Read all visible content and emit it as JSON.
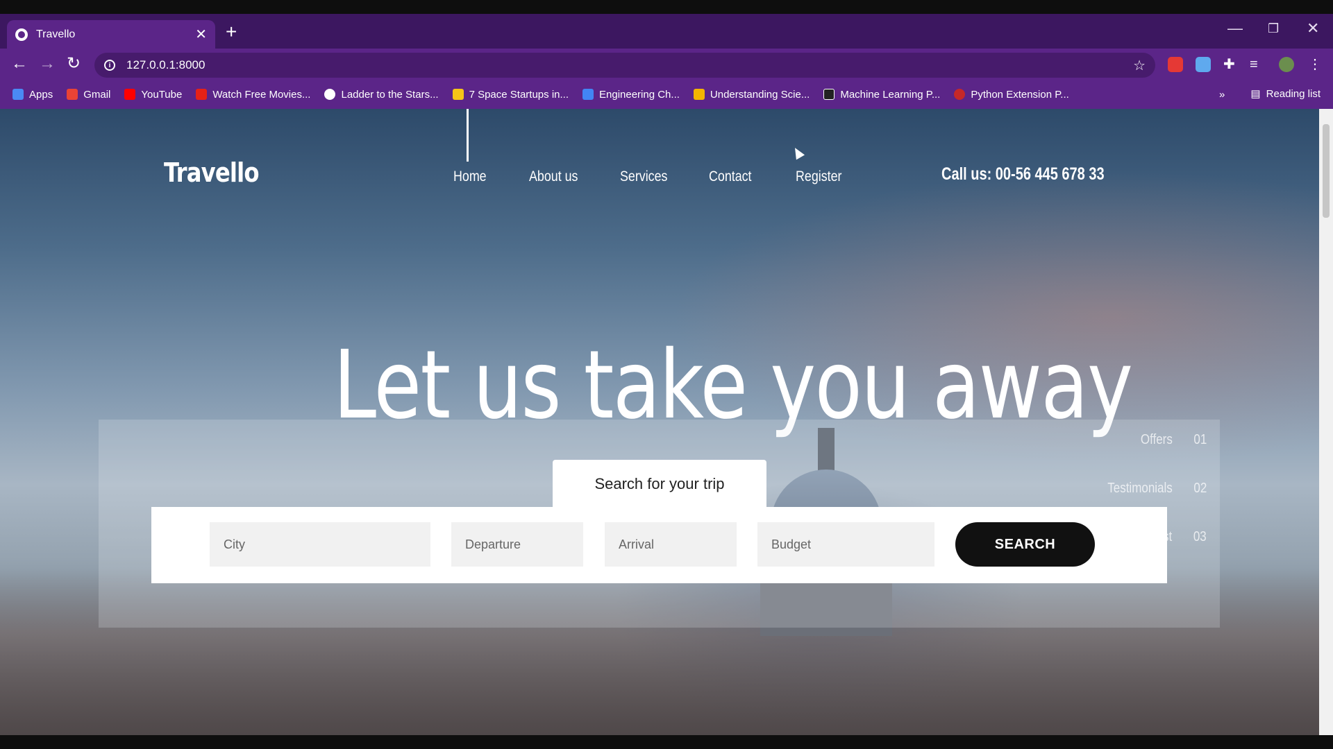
{
  "browser": {
    "tab_title": "Travello",
    "url": "127.0.0.1:8000",
    "bookmarks": [
      {
        "label": "Apps",
        "color": "#4a8af4"
      },
      {
        "label": "Gmail",
        "color": "#ea4335"
      },
      {
        "label": "YouTube",
        "color": "#ff0000"
      },
      {
        "label": "Watch Free Movies...",
        "color": "#e62117"
      },
      {
        "label": "Ladder to the Stars...",
        "color": "#ffffff"
      },
      {
        "label": "7 Space Startups in...",
        "color": "#f5c518"
      },
      {
        "label": "Engineering Ch...",
        "color": "#4285f4"
      },
      {
        "label": "Understanding Scie...",
        "color": "#f4b400"
      },
      {
        "label": "Machine Learning P...",
        "color": "#222222"
      },
      {
        "label": "Python Extension P...",
        "color": "#c62828"
      }
    ],
    "reading_list": "Reading list"
  },
  "site": {
    "logo": "Travello",
    "nav": [
      "Home",
      "About us",
      "Services",
      "Contact",
      "Register"
    ],
    "phone": "Call us: 00-56 445 678 33",
    "hero_title": "Let us take you away",
    "side_nav": [
      {
        "label": "Offers",
        "num": "01"
      },
      {
        "label": "Testimonials",
        "num": "02"
      },
      {
        "label": "Latest",
        "num": "03"
      }
    ],
    "search": {
      "tab_label": "Search for your trip",
      "city_placeholder": "City",
      "departure_placeholder": "Departure",
      "arrival_placeholder": "Arrival",
      "budget_placeholder": "Budget",
      "button_label": "SEARCH"
    }
  }
}
